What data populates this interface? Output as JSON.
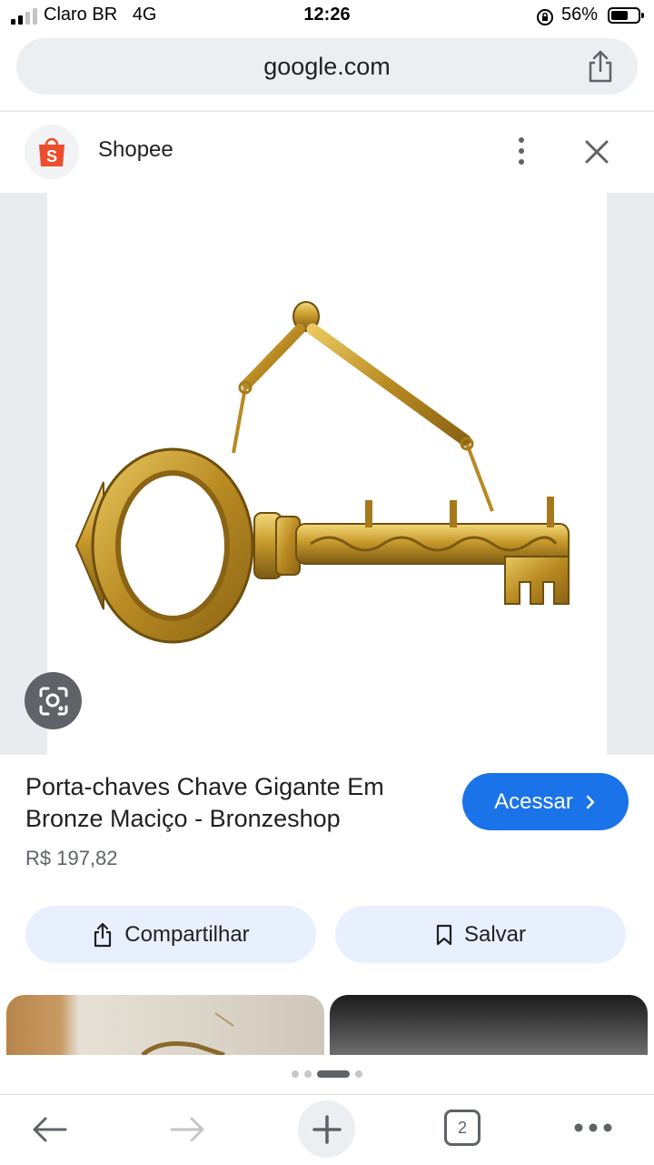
{
  "status_bar": {
    "carrier": "Claro BR",
    "network": "4G",
    "time": "12:26",
    "battery_percent": "56%",
    "signal_bars": 2,
    "battery_level": 0.56
  },
  "browser": {
    "url": "google.com",
    "share_icon": "share-icon"
  },
  "source": {
    "name": "Shopee",
    "logo_icon": "shopee-bag-icon",
    "logo_letter": "S",
    "brand_color": "#ee4d2d"
  },
  "product": {
    "title": "Porta-chaves Chave Gigante Em Bronze Maciço - Bronzeshop",
    "price": "R$ 197,82",
    "visit_label": "Acessar",
    "visit_icon": "chevron-right-icon",
    "accent_color": "#1a73e8"
  },
  "actions": {
    "share_label": "Compartilhar",
    "save_label": "Salvar"
  },
  "pager": {
    "count": 4,
    "active_index": 2
  },
  "toolbar": {
    "tab_count": "2"
  }
}
